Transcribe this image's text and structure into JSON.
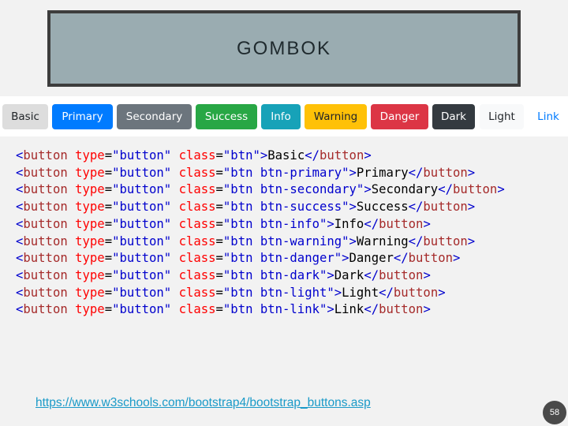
{
  "title": "GOMBOK",
  "buttons": [
    {
      "label": "Basic",
      "bg": "#dddddd",
      "fg": "#212529"
    },
    {
      "label": "Primary",
      "bg": "#007bff",
      "fg": "#ffffff"
    },
    {
      "label": "Secondary",
      "bg": "#6c757d",
      "fg": "#ffffff"
    },
    {
      "label": "Success",
      "bg": "#28a745",
      "fg": "#ffffff"
    },
    {
      "label": "Info",
      "bg": "#17a2b8",
      "fg": "#ffffff"
    },
    {
      "label": "Warning",
      "bg": "#ffc107",
      "fg": "#212529"
    },
    {
      "label": "Danger",
      "bg": "#dc3545",
      "fg": "#ffffff"
    },
    {
      "label": "Dark",
      "bg": "#343a40",
      "fg": "#ffffff"
    },
    {
      "label": "Light",
      "bg": "#f8f9fa",
      "fg": "#212529"
    },
    {
      "label": "Link",
      "bg": "transparent",
      "fg": "#007bff"
    }
  ],
  "code_lines": [
    {
      "class_value": "btn",
      "text": "Basic"
    },
    {
      "class_value": "btn btn-primary",
      "text": "Primary"
    },
    {
      "class_value": "btn btn-secondary",
      "text": "Secondary"
    },
    {
      "class_value": "btn btn-success",
      "text": "Success"
    },
    {
      "class_value": "btn btn-info",
      "text": "Info"
    },
    {
      "class_value": "btn btn-warning",
      "text": "Warning"
    },
    {
      "class_value": "btn btn-danger",
      "text": "Danger"
    },
    {
      "class_value": "btn btn-dark",
      "text": "Dark"
    },
    {
      "class_value": "btn btn-light",
      "text": "Light"
    },
    {
      "class_value": "btn btn-link",
      "text": "Link"
    }
  ],
  "code_tokens": {
    "tag": "button",
    "type_attr": "type",
    "type_value": "button",
    "class_attr": "class"
  },
  "footer": {
    "link": "https://www.w3schools.com/bootstrap4/bootstrap_buttons.asp",
    "page_number": "58"
  },
  "colors": {
    "background": "#f2f2f2",
    "title_box_fill": "#9aacb1",
    "title_box_border": "#3d3d3d",
    "link": "#1a9ac8",
    "code_tag": "#a52a2a",
    "code_attr": "#ff0000",
    "code_value": "#0000cd"
  }
}
